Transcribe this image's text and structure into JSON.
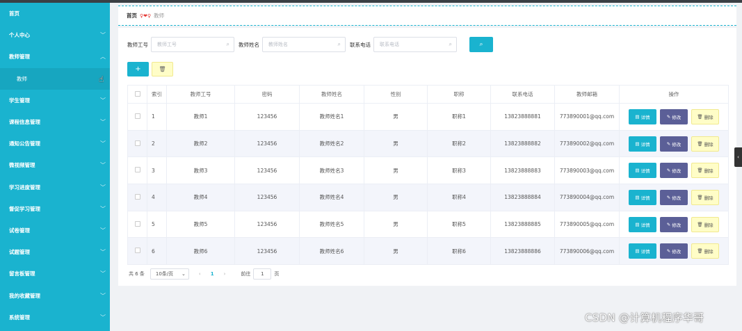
{
  "sidebar": {
    "items": [
      {
        "label": "首页",
        "chevron": ""
      },
      {
        "label": "个人中心",
        "chevron": "﹀"
      },
      {
        "label": "教师管理",
        "chevron": "︿"
      },
      {
        "label": "教师",
        "chevron": "",
        "sub": true
      },
      {
        "label": "学生管理",
        "chevron": "﹀"
      },
      {
        "label": "课程信息管理",
        "chevron": "﹀"
      },
      {
        "label": "通知公告管理",
        "chevron": "﹀"
      },
      {
        "label": "微视频管理",
        "chevron": "﹀"
      },
      {
        "label": "学习进度管理",
        "chevron": "﹀"
      },
      {
        "label": "督促学习管理",
        "chevron": "﹀"
      },
      {
        "label": "试卷管理",
        "chevron": "﹀"
      },
      {
        "label": "试题管理",
        "chevron": "﹀"
      },
      {
        "label": "留言板管理",
        "chevron": "﹀"
      },
      {
        "label": "我的收藏管理",
        "chevron": "﹀"
      },
      {
        "label": "系统管理",
        "chevron": "﹀"
      }
    ]
  },
  "breadcrumb": {
    "home": "首页",
    "separator": "♀❤♀",
    "current": "教师"
  },
  "search": {
    "fields": [
      {
        "label": "教师工号",
        "placeholder": "教师工号"
      },
      {
        "label": "教师姓名",
        "placeholder": "教师姓名"
      },
      {
        "label": "联系电话",
        "placeholder": "联系电话"
      }
    ],
    "button_icon": "search-icon"
  },
  "toolbar": {
    "add_label": "+",
    "delete_label": "🗑"
  },
  "table": {
    "headers": [
      "",
      "索引",
      "教师工号",
      "密码",
      "教师姓名",
      "性别",
      "职称",
      "联系电话",
      "教师邮箱",
      "操作"
    ],
    "rows": [
      {
        "index": "1",
        "id": "教师1",
        "password": "123456",
        "name": "教师姓名1",
        "gender": "男",
        "title": "职称1",
        "phone": "13823888881",
        "email": "773890001@qq.com"
      },
      {
        "index": "2",
        "id": "教师2",
        "password": "123456",
        "name": "教师姓名2",
        "gender": "男",
        "title": "职称2",
        "phone": "13823888882",
        "email": "773890002@qq.com"
      },
      {
        "index": "3",
        "id": "教师3",
        "password": "123456",
        "name": "教师姓名3",
        "gender": "男",
        "title": "职称3",
        "phone": "13823888883",
        "email": "773890003@qq.com"
      },
      {
        "index": "4",
        "id": "教师4",
        "password": "123456",
        "name": "教师姓名4",
        "gender": "男",
        "title": "职称4",
        "phone": "13823888884",
        "email": "773890004@qq.com"
      },
      {
        "index": "5",
        "id": "教师5",
        "password": "123456",
        "name": "教师姓名5",
        "gender": "男",
        "title": "职称5",
        "phone": "13823888885",
        "email": "773890005@qq.com"
      },
      {
        "index": "6",
        "id": "教师6",
        "password": "123456",
        "name": "教师姓名6",
        "gender": "男",
        "title": "职称6",
        "phone": "13823888886",
        "email": "773890006@qq.com"
      }
    ],
    "actions": {
      "detail": "详情",
      "edit": "修改",
      "delete": "删除"
    }
  },
  "pagination": {
    "total": "共 6 条",
    "page_size": "10条/页",
    "current_page": "1",
    "goto_label": "前往",
    "goto_value": "1",
    "page_suffix": "页"
  },
  "watermark": "CSDN @计算机程序华哥",
  "colors": {
    "accent": "#1ab3cf",
    "edit": "#5b5f97",
    "delete": "#fffdc7"
  }
}
